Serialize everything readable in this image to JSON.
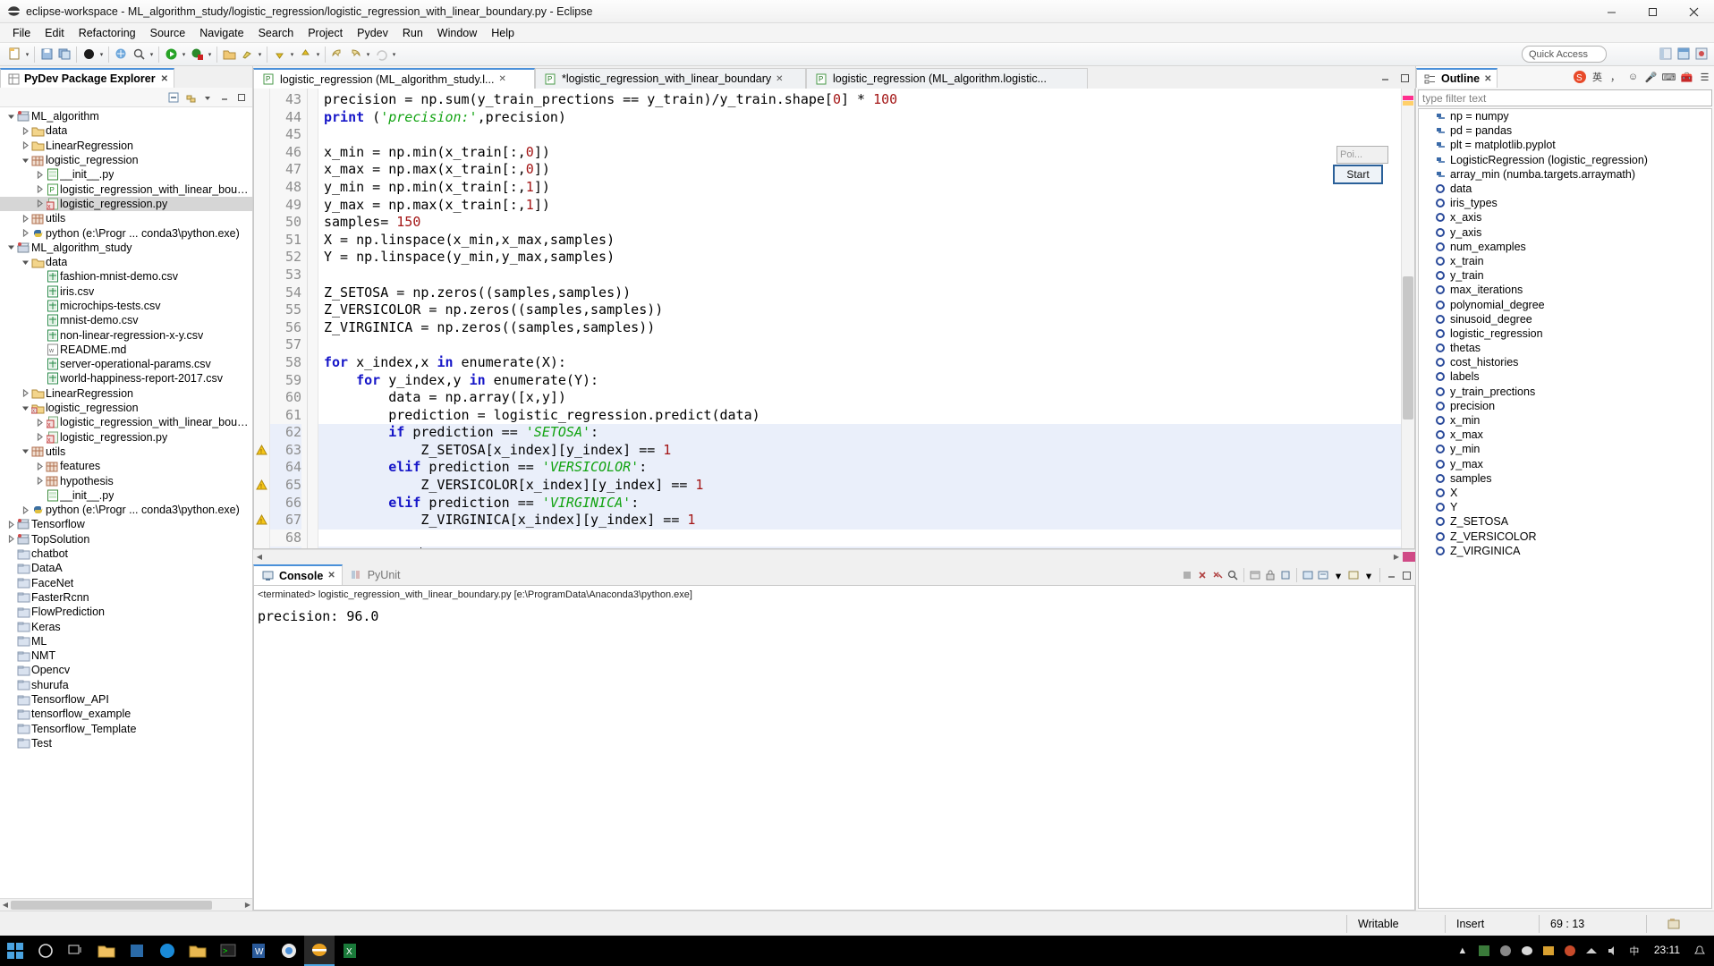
{
  "window": {
    "title": "eclipse-workspace - ML_algorithm_study/logistic_regression/logistic_regression_with_linear_boundary.py - Eclipse",
    "minimize": "–",
    "maximize": "▢",
    "close": "✕"
  },
  "menu": {
    "items": [
      "File",
      "Edit",
      "Refactoring",
      "Source",
      "Navigate",
      "Search",
      "Project",
      "Pydev",
      "Run",
      "Window",
      "Help"
    ]
  },
  "toolbar": {
    "quick_access": "Quick Access"
  },
  "explorer": {
    "tab_label": "PyDev Package Explorer",
    "tab_close": "✕",
    "items": [
      {
        "label": "ML_algorithm",
        "indent": 0,
        "arrow": "v",
        "icon": "project-icon",
        "selected": false
      },
      {
        "label": "data",
        "indent": 1,
        "arrow": ">",
        "icon": "folder-icon",
        "selected": false
      },
      {
        "label": "LinearRegression",
        "indent": 1,
        "arrow": ">",
        "icon": "folder-icon",
        "selected": false
      },
      {
        "label": "logistic_regression",
        "indent": 1,
        "arrow": "v",
        "icon": "package-icon",
        "selected": false
      },
      {
        "label": "__init__.py",
        "indent": 2,
        "arrow": ">",
        "icon": "pyinit-icon",
        "selected": false
      },
      {
        "label": "logistic_regression_with_linear_boundary.",
        "indent": 2,
        "arrow": ">",
        "icon": "py-icon",
        "selected": false
      },
      {
        "label": "logistic_regression.py",
        "indent": 2,
        "arrow": ">",
        "icon": "pyerr-icon",
        "selected": true
      },
      {
        "label": "utils",
        "indent": 1,
        "arrow": ">",
        "icon": "package-icon",
        "selected": false
      },
      {
        "label": "python  (e:\\Progr ... conda3\\python.exe)",
        "indent": 1,
        "arrow": ">",
        "icon": "python-icon",
        "selected": false
      },
      {
        "label": "ML_algorithm_study",
        "indent": 0,
        "arrow": "v",
        "icon": "project-icon",
        "selected": false
      },
      {
        "label": "data",
        "indent": 1,
        "arrow": "v",
        "icon": "folder-icon",
        "selected": false
      },
      {
        "label": "fashion-mnist-demo.csv",
        "indent": 2,
        "arrow": "",
        "icon": "csv-icon",
        "selected": false
      },
      {
        "label": "iris.csv",
        "indent": 2,
        "arrow": "",
        "icon": "csv-icon",
        "selected": false
      },
      {
        "label": "microchips-tests.csv",
        "indent": 2,
        "arrow": "",
        "icon": "csv-icon",
        "selected": false
      },
      {
        "label": "mnist-demo.csv",
        "indent": 2,
        "arrow": "",
        "icon": "csv-icon",
        "selected": false
      },
      {
        "label": "non-linear-regression-x-y.csv",
        "indent": 2,
        "arrow": "",
        "icon": "csv-icon",
        "selected": false
      },
      {
        "label": "README.md",
        "indent": 2,
        "arrow": "",
        "icon": "md-icon",
        "selected": false
      },
      {
        "label": "server-operational-params.csv",
        "indent": 2,
        "arrow": "",
        "icon": "csv-icon",
        "selected": false
      },
      {
        "label": "world-happiness-report-2017.csv",
        "indent": 2,
        "arrow": "",
        "icon": "csv-icon",
        "selected": false
      },
      {
        "label": "LinearRegression",
        "indent": 1,
        "arrow": ">",
        "icon": "folder-icon",
        "selected": false
      },
      {
        "label": "logistic_regression",
        "indent": 1,
        "arrow": "v",
        "icon": "folder-err-icon",
        "selected": false
      },
      {
        "label": "logistic_regression_with_linear_boundary.",
        "indent": 2,
        "arrow": ">",
        "icon": "pyerr-icon",
        "selected": false
      },
      {
        "label": "logistic_regression.py",
        "indent": 2,
        "arrow": ">",
        "icon": "pyerr-icon",
        "selected": false
      },
      {
        "label": "utils",
        "indent": 1,
        "arrow": "v",
        "icon": "package-icon",
        "selected": false
      },
      {
        "label": "features",
        "indent": 2,
        "arrow": ">",
        "icon": "package-icon",
        "selected": false
      },
      {
        "label": "hypothesis",
        "indent": 2,
        "arrow": ">",
        "icon": "package-icon",
        "selected": false
      },
      {
        "label": "__init__.py",
        "indent": 2,
        "arrow": "",
        "icon": "pyinit-icon",
        "selected": false
      },
      {
        "label": "python  (e:\\Progr ... conda3\\python.exe)",
        "indent": 1,
        "arrow": ">",
        "icon": "python-icon",
        "selected": false
      },
      {
        "label": "Tensorflow",
        "indent": 0,
        "arrow": ">",
        "icon": "project-icon",
        "selected": false
      },
      {
        "label": "TopSolution",
        "indent": 0,
        "arrow": ">",
        "icon": "project-icon",
        "selected": false
      },
      {
        "label": "chatbot",
        "indent": 0,
        "arrow": "",
        "icon": "closed-folder-icon",
        "selected": false
      },
      {
        "label": "DataA",
        "indent": 0,
        "arrow": "",
        "icon": "closed-folder-icon",
        "selected": false
      },
      {
        "label": "FaceNet",
        "indent": 0,
        "arrow": "",
        "icon": "closed-folder-icon",
        "selected": false
      },
      {
        "label": "FasterRcnn",
        "indent": 0,
        "arrow": "",
        "icon": "closed-folder-icon",
        "selected": false
      },
      {
        "label": "FlowPrediction",
        "indent": 0,
        "arrow": "",
        "icon": "closed-folder-icon",
        "selected": false
      },
      {
        "label": "Keras",
        "indent": 0,
        "arrow": "",
        "icon": "closed-folder-icon",
        "selected": false
      },
      {
        "label": "ML",
        "indent": 0,
        "arrow": "",
        "icon": "closed-folder-icon",
        "selected": false
      },
      {
        "label": "NMT",
        "indent": 0,
        "arrow": "",
        "icon": "closed-folder-icon",
        "selected": false
      },
      {
        "label": "Opencv",
        "indent": 0,
        "arrow": "",
        "icon": "closed-folder-icon",
        "selected": false
      },
      {
        "label": "shurufa",
        "indent": 0,
        "arrow": "",
        "icon": "closed-folder-icon",
        "selected": false
      },
      {
        "label": "Tensorflow_API",
        "indent": 0,
        "arrow": "",
        "icon": "closed-folder-icon",
        "selected": false
      },
      {
        "label": "tensorflow_example",
        "indent": 0,
        "arrow": "",
        "icon": "closed-folder-icon",
        "selected": false
      },
      {
        "label": "Tensorflow_Template",
        "indent": 0,
        "arrow": "",
        "icon": "closed-folder-icon",
        "selected": false
      },
      {
        "label": "Test",
        "indent": 0,
        "arrow": "",
        "icon": "closed-folder-icon",
        "selected": false
      }
    ]
  },
  "editor": {
    "tabs": [
      {
        "label": "logistic_regression (ML_algorithm_study.l...",
        "active": true,
        "close": "✕",
        "dirty": false
      },
      {
        "label": "*logistic_regression_with_linear_boundary",
        "active": false,
        "close": "✕",
        "dirty": true
      },
      {
        "label": "logistic_regression (ML_algorithm.logistic...",
        "active": false,
        "close": "",
        "dirty": false
      }
    ],
    "lines": [
      {
        "n": "43",
        "warn": false,
        "hl": false,
        "tokens": [
          {
            "t": "precision = np.sum(y_train_prections == y_train)/y_train.shape[",
            "c": "fn"
          },
          {
            "t": "0",
            "c": "num"
          },
          {
            "t": "] * ",
            "c": "fn"
          },
          {
            "t": "100",
            "c": "num"
          }
        ]
      },
      {
        "n": "44",
        "warn": false,
        "hl": false,
        "tokens": [
          {
            "t": "print",
            "c": "kw"
          },
          {
            "t": " (",
            "c": "fn"
          },
          {
            "t": "'precision:'",
            "c": "st"
          },
          {
            "t": ",precision)",
            "c": "fn"
          }
        ]
      },
      {
        "n": "45",
        "warn": false,
        "hl": false,
        "tokens": []
      },
      {
        "n": "46",
        "warn": false,
        "hl": false,
        "tokens": [
          {
            "t": "x_min = np.min(x_train[:,",
            "c": "fn"
          },
          {
            "t": "0",
            "c": "num"
          },
          {
            "t": "])",
            "c": "fn"
          }
        ]
      },
      {
        "n": "47",
        "warn": false,
        "hl": false,
        "tokens": [
          {
            "t": "x_max = np.max(x_train[:,",
            "c": "fn"
          },
          {
            "t": "0",
            "c": "num"
          },
          {
            "t": "])",
            "c": "fn"
          }
        ]
      },
      {
        "n": "48",
        "warn": false,
        "hl": false,
        "tokens": [
          {
            "t": "y_min = np.min(x_train[:,",
            "c": "fn"
          },
          {
            "t": "1",
            "c": "num"
          },
          {
            "t": "])",
            "c": "fn"
          }
        ]
      },
      {
        "n": "49",
        "warn": false,
        "hl": false,
        "tokens": [
          {
            "t": "y_max = np.max(x_train[:,",
            "c": "fn"
          },
          {
            "t": "1",
            "c": "num"
          },
          {
            "t": "])",
            "c": "fn"
          }
        ]
      },
      {
        "n": "50",
        "warn": false,
        "hl": false,
        "tokens": [
          {
            "t": "samples= ",
            "c": "fn"
          },
          {
            "t": "150",
            "c": "num"
          }
        ]
      },
      {
        "n": "51",
        "warn": false,
        "hl": false,
        "tokens": [
          {
            "t": "X = np.linspace(x_min,x_max,samples)",
            "c": "fn"
          }
        ]
      },
      {
        "n": "52",
        "warn": false,
        "hl": false,
        "tokens": [
          {
            "t": "Y = np.linspace(y_min,y_max,samples)",
            "c": "fn"
          }
        ]
      },
      {
        "n": "53",
        "warn": false,
        "hl": false,
        "tokens": []
      },
      {
        "n": "54",
        "warn": false,
        "hl": false,
        "tokens": [
          {
            "t": "Z_SETOSA = np.zeros((samples,samples))",
            "c": "fn"
          }
        ]
      },
      {
        "n": "55",
        "warn": false,
        "hl": false,
        "tokens": [
          {
            "t": "Z_VERSICOLOR = np.zeros((samples,samples))",
            "c": "fn"
          }
        ]
      },
      {
        "n": "56",
        "warn": false,
        "hl": false,
        "tokens": [
          {
            "t": "Z_VIRGINICA = np.zeros((samples,samples))",
            "c": "fn"
          }
        ]
      },
      {
        "n": "57",
        "warn": false,
        "hl": false,
        "tokens": []
      },
      {
        "n": "58",
        "warn": false,
        "hl": false,
        "tokens": [
          {
            "t": "for",
            "c": "kw"
          },
          {
            "t": " x_index,x ",
            "c": "fn"
          },
          {
            "t": "in",
            "c": "kw"
          },
          {
            "t": " enumerate(X):",
            "c": "fn"
          }
        ]
      },
      {
        "n": "59",
        "warn": false,
        "hl": false,
        "tokens": [
          {
            "t": "    ",
            "c": "fn"
          },
          {
            "t": "for",
            "c": "kw"
          },
          {
            "t": " y_index,y ",
            "c": "fn"
          },
          {
            "t": "in",
            "c": "kw"
          },
          {
            "t": " enumerate(Y):",
            "c": "fn"
          }
        ]
      },
      {
        "n": "60",
        "warn": false,
        "hl": false,
        "tokens": [
          {
            "t": "        data = np.array([x,y])",
            "c": "fn"
          }
        ]
      },
      {
        "n": "61",
        "warn": false,
        "hl": false,
        "tokens": [
          {
            "t": "        prediction = logistic_regression.predict(data)",
            "c": "fn"
          }
        ]
      },
      {
        "n": "62",
        "warn": false,
        "hl": true,
        "tokens": [
          {
            "t": "        ",
            "c": "fn"
          },
          {
            "t": "if",
            "c": "kw"
          },
          {
            "t": " prediction == ",
            "c": "fn"
          },
          {
            "t": "'SETOSA'",
            "c": "st"
          },
          {
            "t": ":",
            "c": "fn"
          }
        ]
      },
      {
        "n": "63",
        "warn": true,
        "hl": true,
        "tokens": [
          {
            "t": "            Z_SETOSA[x_index][y_index] == ",
            "c": "fn"
          },
          {
            "t": "1",
            "c": "num"
          }
        ]
      },
      {
        "n": "64",
        "warn": false,
        "hl": true,
        "tokens": [
          {
            "t": "        ",
            "c": "fn"
          },
          {
            "t": "elif",
            "c": "kw"
          },
          {
            "t": " prediction == ",
            "c": "fn"
          },
          {
            "t": "'VERSICOLOR'",
            "c": "st"
          },
          {
            "t": ":",
            "c": "fn"
          }
        ]
      },
      {
        "n": "65",
        "warn": true,
        "hl": true,
        "tokens": [
          {
            "t": "            Z_VERSICOLOR[x_index][y_index] == ",
            "c": "fn"
          },
          {
            "t": "1",
            "c": "num"
          }
        ]
      },
      {
        "n": "66",
        "warn": false,
        "hl": true,
        "tokens": [
          {
            "t": "        ",
            "c": "fn"
          },
          {
            "t": "elif",
            "c": "kw"
          },
          {
            "t": " prediction == ",
            "c": "fn"
          },
          {
            "t": "'VIRGINICA'",
            "c": "st"
          },
          {
            "t": ":",
            "c": "fn"
          }
        ]
      },
      {
        "n": "67",
        "warn": true,
        "hl": true,
        "tokens": [
          {
            "t": "            Z_VIRGINICA[x_index][y_index] == ",
            "c": "fn"
          },
          {
            "t": "1",
            "c": "num"
          }
        ]
      },
      {
        "n": "68",
        "warn": false,
        "hl": false,
        "tokens": []
      },
      {
        "n": "69",
        "warn": false,
        "hl": true,
        "caret": true,
        "tokens": [
          {
            "t": "            ",
            "c": "fn"
          }
        ]
      }
    ]
  },
  "console": {
    "tabs": [
      {
        "label": "Console",
        "active": true,
        "close": "✕"
      },
      {
        "label": "PyUnit",
        "active": false,
        "close": ""
      }
    ],
    "launch_line": "<terminated> logistic_regression_with_linear_boundary.py [e:\\ProgramData\\Anaconda3\\python.exe]",
    "output": "precision: 96.0"
  },
  "outline": {
    "tab_label": "Outline",
    "tab_close": "✕",
    "filter_placeholder": "type filter text",
    "items": [
      {
        "label": "np = numpy",
        "icon": "import-icon"
      },
      {
        "label": "pd = pandas",
        "icon": "import-icon"
      },
      {
        "label": "plt = matplotlib.pyplot",
        "icon": "import-icon"
      },
      {
        "label": "LogisticRegression (logistic_regression)",
        "icon": "import-icon"
      },
      {
        "label": "array_min (numba.targets.arraymath)",
        "icon": "import-icon"
      },
      {
        "label": "data",
        "icon": "attribute-icon"
      },
      {
        "label": "iris_types",
        "icon": "attribute-icon"
      },
      {
        "label": "x_axis",
        "icon": "attribute-icon"
      },
      {
        "label": "y_axis",
        "icon": "attribute-icon"
      },
      {
        "label": "num_examples",
        "icon": "attribute-icon"
      },
      {
        "label": "x_train",
        "icon": "attribute-icon"
      },
      {
        "label": "y_train",
        "icon": "attribute-icon"
      },
      {
        "label": "max_iterations",
        "icon": "attribute-icon"
      },
      {
        "label": "polynomial_degree",
        "icon": "attribute-icon"
      },
      {
        "label": "sinusoid_degree",
        "icon": "attribute-icon"
      },
      {
        "label": "logistic_regression",
        "icon": "attribute-icon"
      },
      {
        "label": "thetas",
        "icon": "attribute-icon"
      },
      {
        "label": "cost_histories",
        "icon": "attribute-icon"
      },
      {
        "label": "labels",
        "icon": "attribute-icon"
      },
      {
        "label": "y_train_prections",
        "icon": "attribute-icon"
      },
      {
        "label": "precision",
        "icon": "attribute-icon"
      },
      {
        "label": "x_min",
        "icon": "attribute-icon"
      },
      {
        "label": "x_max",
        "icon": "attribute-icon"
      },
      {
        "label": "y_min",
        "icon": "attribute-icon"
      },
      {
        "label": "y_max",
        "icon": "attribute-icon"
      },
      {
        "label": "samples",
        "icon": "attribute-icon"
      },
      {
        "label": "X",
        "icon": "attribute-icon"
      },
      {
        "label": "Y",
        "icon": "attribute-icon"
      },
      {
        "label": "Z_SETOSA",
        "icon": "attribute-icon"
      },
      {
        "label": "Z_VERSICOLOR",
        "icon": "attribute-icon"
      },
      {
        "label": "Z_VIRGINICA",
        "icon": "attribute-icon"
      }
    ]
  },
  "ime": {
    "poi_label": "Poi...",
    "start_label": "Start",
    "lang_label": "英",
    "items": [
      "S",
      "英",
      "✎",
      "☺",
      "⌨",
      "🎤",
      "☰",
      "⚙"
    ]
  },
  "statusbar": {
    "writable": "Writable",
    "insert": "Insert",
    "position": "69 : 13"
  },
  "taskbar": {
    "clock_time": "23:11",
    "clock_date": ""
  },
  "colors": {
    "accent": "#4a90d9",
    "keyword": "#1616c8",
    "string": "#12a312",
    "number": "#a31515",
    "selection": "#d6d6d6",
    "highlight": "#eaeffa",
    "warning": "#f5c518"
  }
}
